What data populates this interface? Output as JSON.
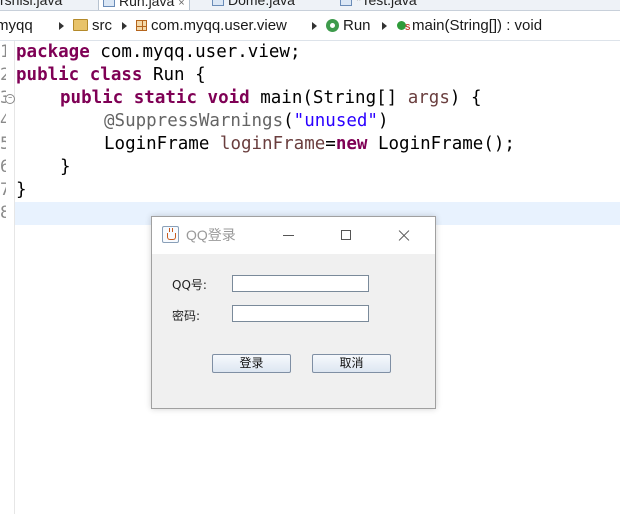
{
  "tabs": [
    {
      "label": "rshisi.java",
      "active": false
    },
    {
      "label": "Run.java",
      "active": true,
      "close": "×"
    },
    {
      "label": "Dome.java",
      "active": false
    },
    {
      "label": "*Test.java",
      "active": false
    }
  ],
  "breadcrumb": {
    "project": "myqq",
    "folder": "src",
    "package": "com.myqq.user.view",
    "class": "Run",
    "method": "main(String[]) : void"
  },
  "editor": {
    "line_numbers": [
      "1",
      "2",
      "3",
      "4",
      "5",
      "6",
      "7",
      "8"
    ],
    "lines": [
      {
        "kw1": "package",
        "rest": " com.myqq.user.view;"
      },
      {
        "kw1": "public",
        "kw2": "class",
        "rest": " Run {"
      },
      {
        "kw1": "public",
        "kw2": "static",
        "kw3": "void",
        "rest": " main(String[] ",
        "param": "args",
        "tail": ") {"
      },
      {
        "ann": "@SuppressWarnings",
        "open": "(",
        "str": "\"unused\"",
        "close": ")"
      },
      {
        "type": "LoginFrame ",
        "var": "loginFrame",
        "eq": "=",
        "kw": "new",
        "rest": " LoginFrame();"
      },
      {
        "text": "}"
      },
      {
        "text": "}"
      }
    ]
  },
  "dialog": {
    "title": "QQ登录",
    "qq_label": "QQ号:",
    "password_label": "密码:",
    "qq_value": "",
    "password_value": "",
    "login_button": "登录",
    "cancel_button": "取消",
    "icons": {
      "app": "java-cup-icon",
      "minimize": "minimize-icon",
      "maximize": "maximize-icon",
      "close": "close-icon"
    }
  }
}
